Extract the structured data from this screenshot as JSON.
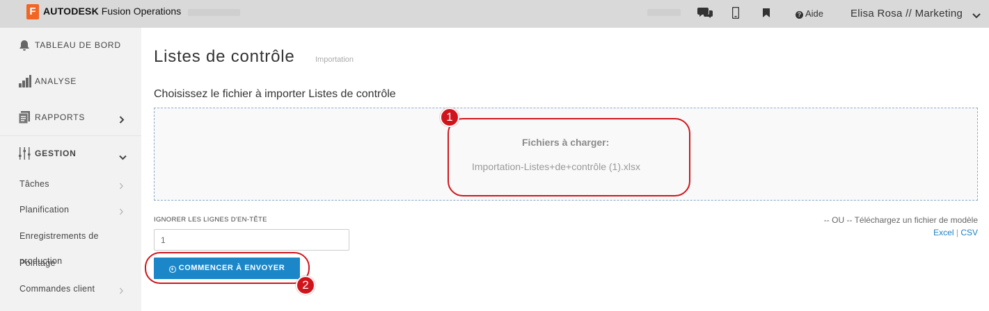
{
  "app": {
    "logo_letter": "F",
    "brand_bold": "AUTODESK",
    "brand_rest": " Fusion Operations",
    "help_label": "Aide",
    "user_label": "Elisa Rosa // Marketing"
  },
  "sidebar": {
    "items": [
      {
        "label": "TABLEAU DE BORD",
        "icon": "bell-icon"
      },
      {
        "label": "ANALYSE",
        "icon": "bar-chart-icon"
      },
      {
        "label": "RAPPORTS",
        "icon": "document-icon"
      },
      {
        "label": "GESTION",
        "icon": "sliders-icon"
      }
    ],
    "subitems": [
      {
        "label": "Tâches"
      },
      {
        "label": "Planification"
      },
      {
        "label": "Enregistrements de"
      },
      {
        "label": "production"
      },
      {
        "label": "Pointage"
      },
      {
        "label": "Commandes client"
      }
    ]
  },
  "main": {
    "title": "Listes de contrôle",
    "subtitle": "Importation",
    "section_title": "Choisissez le fichier à importer Listes de contrôle",
    "files_label": "Fichiers à charger:",
    "file_name": "Importation-Listes+de+contrôle (1).xlsx",
    "ignore_label": "IGNORER LES LIGNES D'EN-TÊTE",
    "ignore_value": "1",
    "or_text": "-- OU -- Téléchargez un fichier de modèle",
    "excel_link": "Excel",
    "separator": "|",
    "csv_link": "CSV",
    "start_button": "COMMENCER À ENVOYER"
  },
  "annotations": {
    "badge_1": "1",
    "badge_2": "2",
    "color": "#d0141c"
  },
  "colors": {
    "accent": "#1b87c9",
    "logo": "#f26522",
    "topbar": "#d9d9d9",
    "sidebar": "#f2f2f2"
  }
}
